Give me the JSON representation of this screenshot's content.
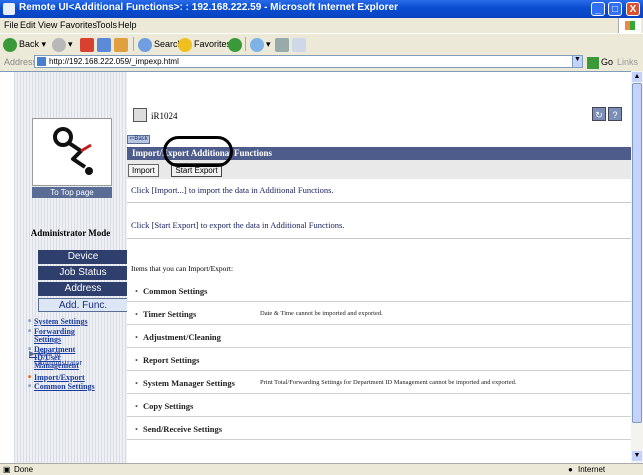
{
  "window": {
    "title": "Remote UI<Additional Functions>: : 192.168.222.59 - Microsoft Internet Explorer",
    "minimize": "_",
    "maximize": "□",
    "close": "X"
  },
  "menu": [
    "File",
    "Edit",
    "View",
    "Favorites",
    "Tools",
    "Help"
  ],
  "toolbar": {
    "back": "Back",
    "search": "Search",
    "favorites": "Favorites"
  },
  "address": {
    "label": "Address",
    "url": "http://192.168.222.059/_impexp.html",
    "go": "Go",
    "links": "Links"
  },
  "status": {
    "left": "Done",
    "zone": "Internet"
  },
  "nav": {
    "to_top": "To Top page",
    "admin_mode": "Administrator Mode",
    "buttons": [
      "Device",
      "Job Status",
      "Address",
      "Add. Func."
    ],
    "sublinks": [
      "System Settings",
      "Forwarding Settings",
      "Department ID/User Management",
      "Import/Export",
      "Common Settings"
    ],
    "mail_to": "Mail to Administrator"
  },
  "main": {
    "device_name": "iR1024",
    "refresh_icon": "↻",
    "help_icon": "?",
    "back_label": "⇦Back",
    "page_title": "Import/Export Additional Functions",
    "tab_import": "Import",
    "tab_export": "Start Export",
    "import_text": "Click [Import...] to import the data in Additional Functions.",
    "export_text": "Click [Start Export] to export the data in Additional Functions.",
    "items_caption": "Items that you can Import/Export:",
    "items": [
      {
        "name": "Common Settings",
        "note": ""
      },
      {
        "name": "Timer Settings",
        "note": "Date & Time cannot be imported and exported."
      },
      {
        "name": "Adjustment/Cleaning",
        "note": ""
      },
      {
        "name": "Report Settings",
        "note": ""
      },
      {
        "name": "System Manager Settings",
        "note": "Print Total/Forwarding Settings for Department ID Management cannot be imported and exported."
      },
      {
        "name": "Copy Settings",
        "note": ""
      },
      {
        "name": "Send/Receive Settings",
        "note": ""
      }
    ]
  }
}
